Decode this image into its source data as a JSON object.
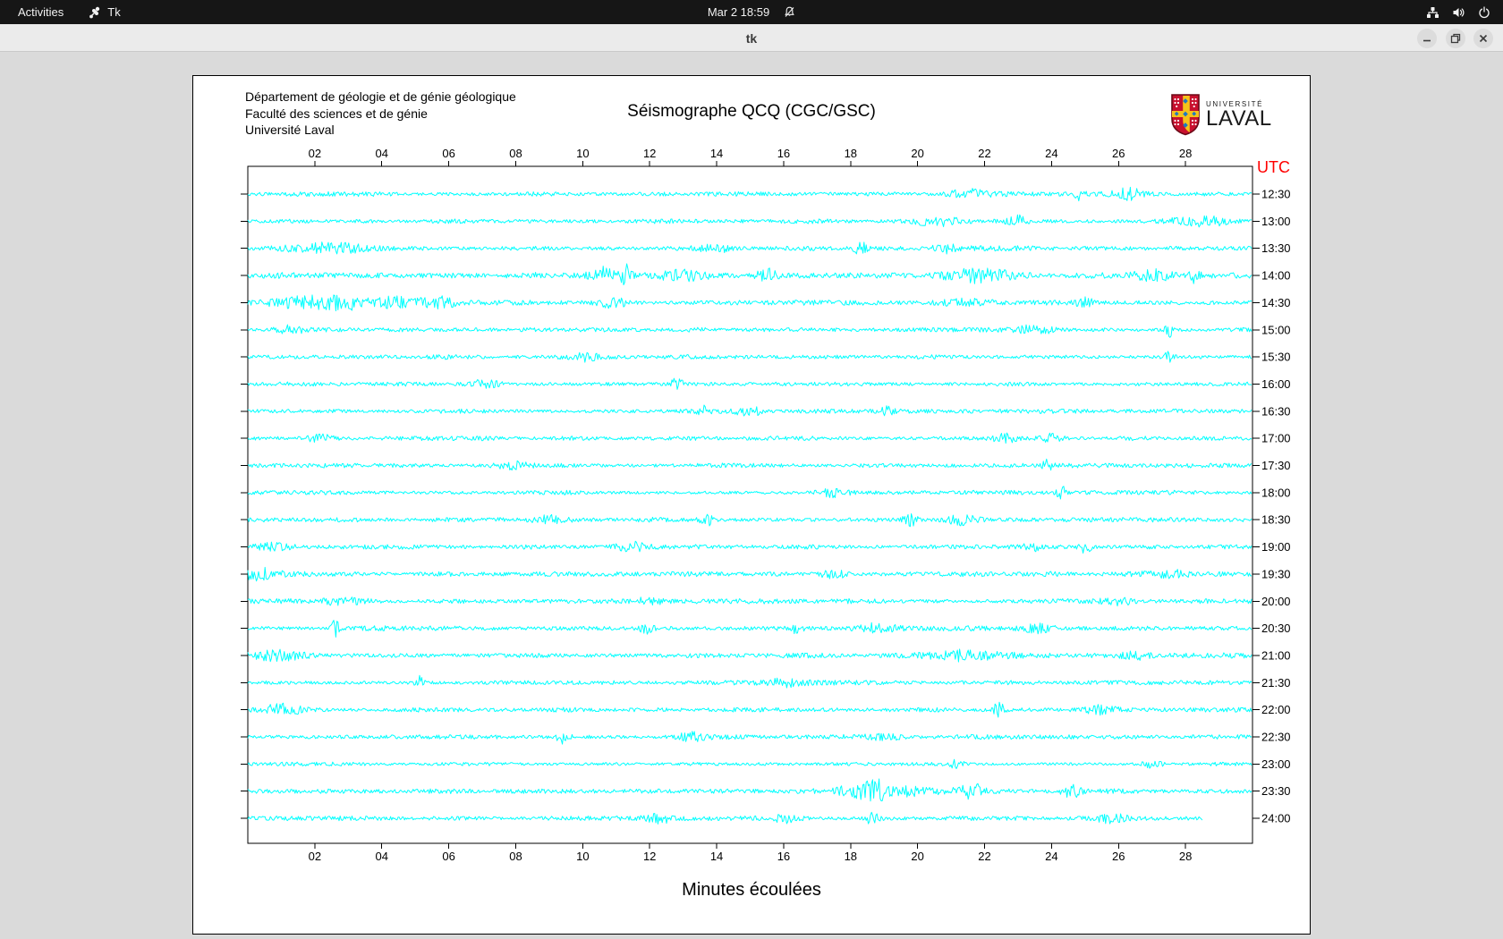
{
  "topbar": {
    "activities_label": "Activities",
    "app_name": "Tk",
    "clock": "Mar 2 18:59",
    "status_icons": [
      "notifications-muted",
      "wired-network",
      "volume",
      "power"
    ]
  },
  "titlebar": {
    "title": "tk",
    "buttons": [
      "minimize",
      "maximize",
      "close"
    ]
  },
  "page": {
    "org_lines": "Département de géologie et de génie géologique\nFaculté des sciences et de génie\nUniversité Laval",
    "title": "Séismographe QCQ (CGC/GSC)",
    "utc_label": "UTC",
    "xlabel": "Minutes écoulées",
    "logo_small": "UNIVERSITÉ",
    "logo_large": "LAVAL"
  },
  "chart_data": {
    "type": "seismograph-helicorder",
    "title": "Séismographe QCQ (CGC/GSC)",
    "xlabel": "Minutes écoulées",
    "x_range_minutes": [
      0,
      30
    ],
    "x_tick_labels": [
      "02",
      "04",
      "06",
      "08",
      "10",
      "12",
      "14",
      "16",
      "18",
      "20",
      "22",
      "24",
      "26",
      "28"
    ],
    "x_tick_minutes": [
      2,
      4,
      6,
      8,
      10,
      12,
      14,
      16,
      18,
      20,
      22,
      24,
      26,
      28
    ],
    "trace_color": "#00FFFF",
    "utc_label": "UTC",
    "traces": [
      {
        "label": "12:30",
        "base_amp": 2.2,
        "end": 30,
        "events": [
          [
            24.8,
            7,
            0.1
          ],
          [
            26.3,
            5,
            0.3
          ],
          [
            21.5,
            4,
            0.4
          ]
        ]
      },
      {
        "label": "13:00",
        "base_amp": 2.2,
        "end": 30,
        "events": [
          [
            20.6,
            5,
            0.5
          ],
          [
            23.0,
            5,
            0.2
          ],
          [
            28.5,
            4,
            0.6
          ]
        ]
      },
      {
        "label": "13:30",
        "base_amp": 2.4,
        "end": 30,
        "events": [
          [
            2.5,
            5,
            0.8
          ],
          [
            18.3,
            6,
            0.15
          ],
          [
            20.8,
            6,
            0.2
          ],
          [
            14.0,
            4,
            0.3
          ]
        ]
      },
      {
        "label": "14:00",
        "base_amp": 2.8,
        "end": 30,
        "events": [
          [
            10.6,
            8,
            0.25
          ],
          [
            11.3,
            16,
            0.1
          ],
          [
            13.0,
            5,
            0.5
          ],
          [
            15.5,
            6,
            0.2
          ],
          [
            21.8,
            6,
            0.8
          ],
          [
            27.0,
            5,
            0.4
          ],
          [
            28.3,
            12,
            0.08
          ]
        ]
      },
      {
        "label": "14:30",
        "base_amp": 2.6,
        "end": 30,
        "events": [
          [
            2.0,
            6,
            0.8
          ],
          [
            2.9,
            8,
            0.15
          ],
          [
            4.5,
            6,
            0.6
          ],
          [
            5.8,
            5,
            0.3
          ],
          [
            10.9,
            5,
            0.3
          ],
          [
            25.0,
            6,
            0.15
          ],
          [
            21.5,
            4,
            0.5
          ]
        ]
      },
      {
        "label": "15:00",
        "base_amp": 2.2,
        "end": 30,
        "events": [
          [
            1.3,
            5,
            0.3
          ],
          [
            23.5,
            4,
            0.4
          ],
          [
            27.5,
            10,
            0.07
          ]
        ]
      },
      {
        "label": "15:30",
        "base_amp": 2.3,
        "end": 30,
        "events": [
          [
            10.0,
            4,
            0.3
          ],
          [
            27.5,
            6,
            0.1
          ]
        ]
      },
      {
        "label": "16:00",
        "base_amp": 2.0,
        "end": 30,
        "events": [
          [
            12.8,
            5,
            0.15
          ],
          [
            7.0,
            3.5,
            0.4
          ]
        ]
      },
      {
        "label": "16:30",
        "base_amp": 2.1,
        "end": 30,
        "events": [
          [
            13.6,
            6,
            0.12
          ],
          [
            19.1,
            7,
            0.1
          ],
          [
            15.0,
            4,
            0.3
          ]
        ]
      },
      {
        "label": "17:00",
        "base_amp": 2.1,
        "end": 30,
        "events": [
          [
            2.2,
            4,
            0.3
          ],
          [
            22.6,
            4,
            0.3
          ],
          [
            24.0,
            4,
            0.2
          ]
        ]
      },
      {
        "label": "17:30",
        "base_amp": 2.1,
        "end": 30,
        "events": [
          [
            23.9,
            6,
            0.12
          ],
          [
            8.0,
            3.5,
            0.4
          ]
        ]
      },
      {
        "label": "18:00",
        "base_amp": 2.1,
        "end": 30,
        "events": [
          [
            24.3,
            6,
            0.12
          ],
          [
            17.5,
            4,
            0.3
          ]
        ]
      },
      {
        "label": "18:30",
        "base_amp": 2.2,
        "end": 30,
        "events": [
          [
            13.7,
            7,
            0.12
          ],
          [
            19.8,
            6,
            0.15
          ],
          [
            21.3,
            5,
            0.3
          ],
          [
            9.0,
            4,
            0.3
          ]
        ]
      },
      {
        "label": "19:00",
        "base_amp": 2.2,
        "end": 30,
        "events": [
          [
            0.8,
            4,
            0.4
          ],
          [
            23.4,
            5,
            0.2
          ],
          [
            25.0,
            7,
            0.12
          ],
          [
            11.5,
            4,
            0.3
          ]
        ]
      },
      {
        "label": "19:30",
        "base_amp": 2.4,
        "end": 30,
        "events": [
          [
            0.3,
            6,
            0.4
          ],
          [
            17.5,
            4,
            0.3
          ],
          [
            27.5,
            4,
            0.4
          ]
        ]
      },
      {
        "label": "20:00",
        "base_amp": 2.3,
        "end": 30,
        "events": [
          [
            2.8,
            5,
            0.4
          ],
          [
            12.0,
            4,
            0.3
          ],
          [
            26.0,
            4,
            0.3
          ]
        ]
      },
      {
        "label": "20:30",
        "base_amp": 2.3,
        "end": 30,
        "events": [
          [
            2.6,
            9,
            0.1
          ],
          [
            11.9,
            6,
            0.12
          ],
          [
            16.4,
            6,
            0.12
          ],
          [
            18.8,
            5,
            0.4
          ],
          [
            23.5,
            4,
            0.3
          ]
        ]
      },
      {
        "label": "21:00",
        "base_amp": 2.5,
        "end": 30,
        "events": [
          [
            0.8,
            5,
            0.6
          ],
          [
            21.5,
            5,
            0.8
          ],
          [
            26.5,
            4,
            0.3
          ]
        ]
      },
      {
        "label": "21:30",
        "base_amp": 2.2,
        "end": 30,
        "events": [
          [
            5.1,
            7,
            0.1
          ],
          [
            16.0,
            3.5,
            0.4
          ]
        ]
      },
      {
        "label": "22:00",
        "base_amp": 2.2,
        "end": 30,
        "events": [
          [
            1.0,
            5,
            0.4
          ],
          [
            22.4,
            11,
            0.1
          ],
          [
            25.5,
            4,
            0.3
          ]
        ]
      },
      {
        "label": "22:30",
        "base_amp": 2.2,
        "end": 30,
        "events": [
          [
            9.4,
            6,
            0.12
          ],
          [
            13.2,
            4,
            0.3
          ],
          [
            19.0,
            4,
            0.3
          ]
        ]
      },
      {
        "label": "23:00",
        "base_amp": 1.9,
        "end": 30,
        "events": [
          [
            21.2,
            5,
            0.15
          ],
          [
            27.0,
            4,
            0.2
          ]
        ]
      },
      {
        "label": "23:30",
        "base_amp": 2.3,
        "end": 30,
        "events": [
          [
            18.3,
            7,
            0.5
          ],
          [
            18.8,
            8,
            0.2
          ],
          [
            21.6,
            7,
            0.3
          ],
          [
            24.6,
            6,
            0.2
          ],
          [
            20.0,
            5,
            0.5
          ]
        ]
      },
      {
        "label": "24:00",
        "base_amp": 2.1,
        "end": 28.5,
        "events": [
          [
            12.3,
            4,
            0.3
          ],
          [
            16.1,
            4,
            0.3
          ],
          [
            18.6,
            5,
            0.2
          ],
          [
            25.8,
            5,
            0.3
          ]
        ]
      }
    ]
  }
}
